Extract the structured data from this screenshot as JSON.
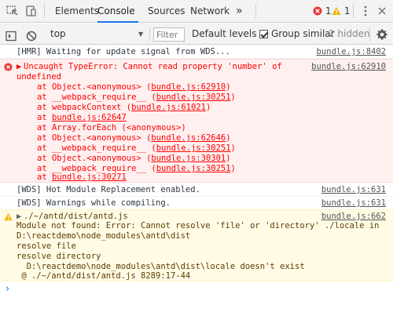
{
  "tabs": [
    {
      "label": "Elements"
    },
    {
      "label": "Console"
    },
    {
      "label": "Sources"
    },
    {
      "label": "Network"
    }
  ],
  "more_tabs_glyph": "»",
  "counts": {
    "errors": "1",
    "warnings": "1"
  },
  "toolbar": {
    "context": "top",
    "filter_placeholder": "Filter",
    "levels": "Default levels",
    "group_similar": "Group similar",
    "hidden": "2 hidden"
  },
  "colors": {
    "error": "#ff0000",
    "warning": "#ffc107",
    "accent": "#1a73e8"
  },
  "messages": {
    "hmr": {
      "text": "[HMR] Waiting for update signal from WDS...",
      "source": "bundle.js:8402"
    },
    "error": {
      "line1": "Uncaught TypeError: Cannot read property 'number' of",
      "line2": "undefined",
      "source": "bundle.js:62910",
      "frames": [
        {
          "prefix": "at Object.<anonymous> (",
          "link": "bundle.js:62910",
          "suffix": ")"
        },
        {
          "prefix": "at __webpack_require__ (",
          "link": "bundle.js:30251",
          "suffix": ")"
        },
        {
          "prefix": "at webpackContext (",
          "link": "bundle.js:61021",
          "suffix": ")"
        },
        {
          "prefix": "at ",
          "link": "bundle.js:62647",
          "suffix": ""
        },
        {
          "prefix": "at Array.forEach (<anonymous>)",
          "link": "",
          "suffix": ""
        },
        {
          "prefix": "at Object.<anonymous> (",
          "link": "bundle.js:62646",
          "suffix": ")"
        },
        {
          "prefix": "at __webpack_require__ (",
          "link": "bundle.js:30251",
          "suffix": ")"
        },
        {
          "prefix": "at Object.<anonymous> (",
          "link": "bundle.js:30301",
          "suffix": ")"
        },
        {
          "prefix": "at __webpack_require__ (",
          "link": "bundle.js:30251",
          "suffix": ")"
        },
        {
          "prefix": "at ",
          "link": "bundle.js:30271",
          "suffix": ""
        }
      ]
    },
    "wds1": {
      "text": "[WDS] Hot Module Replacement enabled.",
      "source": "bundle.js:631"
    },
    "wds2": {
      "text": "[WDS] Warnings while compiling.",
      "source": "bundle.js:631"
    },
    "warning": {
      "source": "bundle.js:662",
      "lines": [
        "./~/antd/dist/antd.js",
        "Module not found: Error: Cannot resolve 'file' or 'directory' ./locale in",
        "D:\\reactdemo\\node_modules\\antd\\dist",
        "resolve file",
        "resolve directory",
        "  D:\\reactdemo\\node_modules\\antd\\dist\\locale doesn't exist",
        " @ ./~/antd/dist/antd.js 8289:17-44"
      ]
    }
  },
  "prompt_glyph": "›"
}
